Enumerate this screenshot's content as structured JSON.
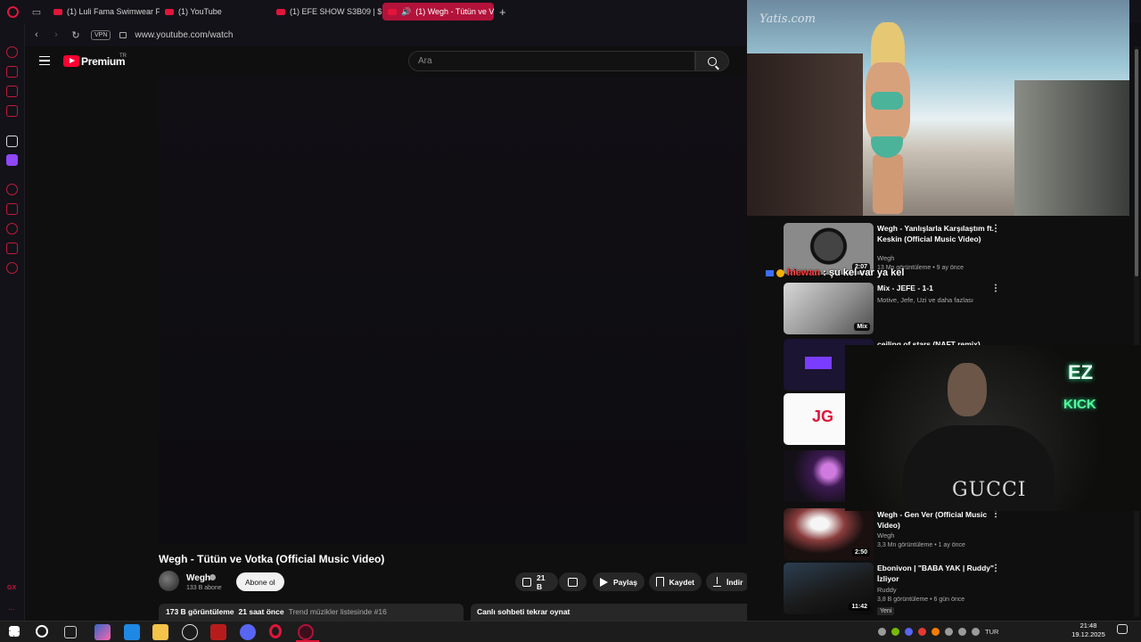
{
  "browser": {
    "tabs": [
      {
        "label": "(1) Luli Fama Swimwear F..."
      },
      {
        "label": "(1) YouTube"
      },
      {
        "label": "(1) EFE SHOW S3B09 | $..."
      },
      {
        "label": "(1) Wegh - Tütün ve V..."
      }
    ],
    "url": "www.youtube.com/watch",
    "vpn_label": "VPN",
    "sidebar_gx": "GX",
    "sidebar_more": "..."
  },
  "youtube": {
    "brand": "Premium",
    "country": "TR",
    "search_placeholder": "Ara",
    "video": {
      "title": "Wegh - Tütün ve Votka (Official Music Video)",
      "channel": "Wegh",
      "subs": "133 B abone",
      "subscribe_label": "Abone ol",
      "likes": "21 B",
      "share_label": "Paylaş",
      "save_label": "Kaydet",
      "download_label": "İndir",
      "views": "173 B görüntüleme",
      "age": "21 saat önce",
      "trend": "Trend müzikler listesinde #16",
      "chat_replay": "Canlı sohbeti tekrar oynat"
    },
    "recommendations": [
      {
        "title": "Wegh - Yanlışlarla Karşılaştım ft. Keskin (Official Music Video)",
        "channel": "Wegh",
        "meta": "13 Mn görüntüleme • 9 ay önce",
        "duration": "2:07"
      },
      {
        "title": "Mix - JEFE - 1-1",
        "channel": "Motive, Jefe, Uzi ve daha fazlası",
        "meta": "",
        "duration": "Mix"
      },
      {
        "title": "ceiling of stars (NAFT remix)",
        "channel": "",
        "meta": "",
        "duration": ""
      },
      {
        "title": "",
        "channel": "",
        "meta": "",
        "duration": ""
      },
      {
        "title": "",
        "channel": "",
        "meta": "",
        "duration": ""
      },
      {
        "title": "Wegh - Gen Ver (Official Music Video)",
        "channel": "Wegh",
        "meta": "3,3 Mn görüntüleme • 1 ay önce",
        "duration": "2:50"
      },
      {
        "title": "Ebonivon | \"BABA YAK | Ruddy\" İzliyor",
        "channel": "Ruddy",
        "meta": "3,8 B görüntüleme • 6 gün önce",
        "duration": "11:42",
        "badge": "Yeni"
      }
    ]
  },
  "overlays": {
    "chat_user": "hiewan",
    "chat_message": ": şu kel var ya kel",
    "watermark": "Yatis.com",
    "cam_logo_top": "EZ",
    "cam_logo_bottom": "KICK",
    "cam_shirt": "GUCCI"
  },
  "taskbar": {
    "lang": "TUR",
    "time": "21:48",
    "date": "19.12.2025"
  }
}
